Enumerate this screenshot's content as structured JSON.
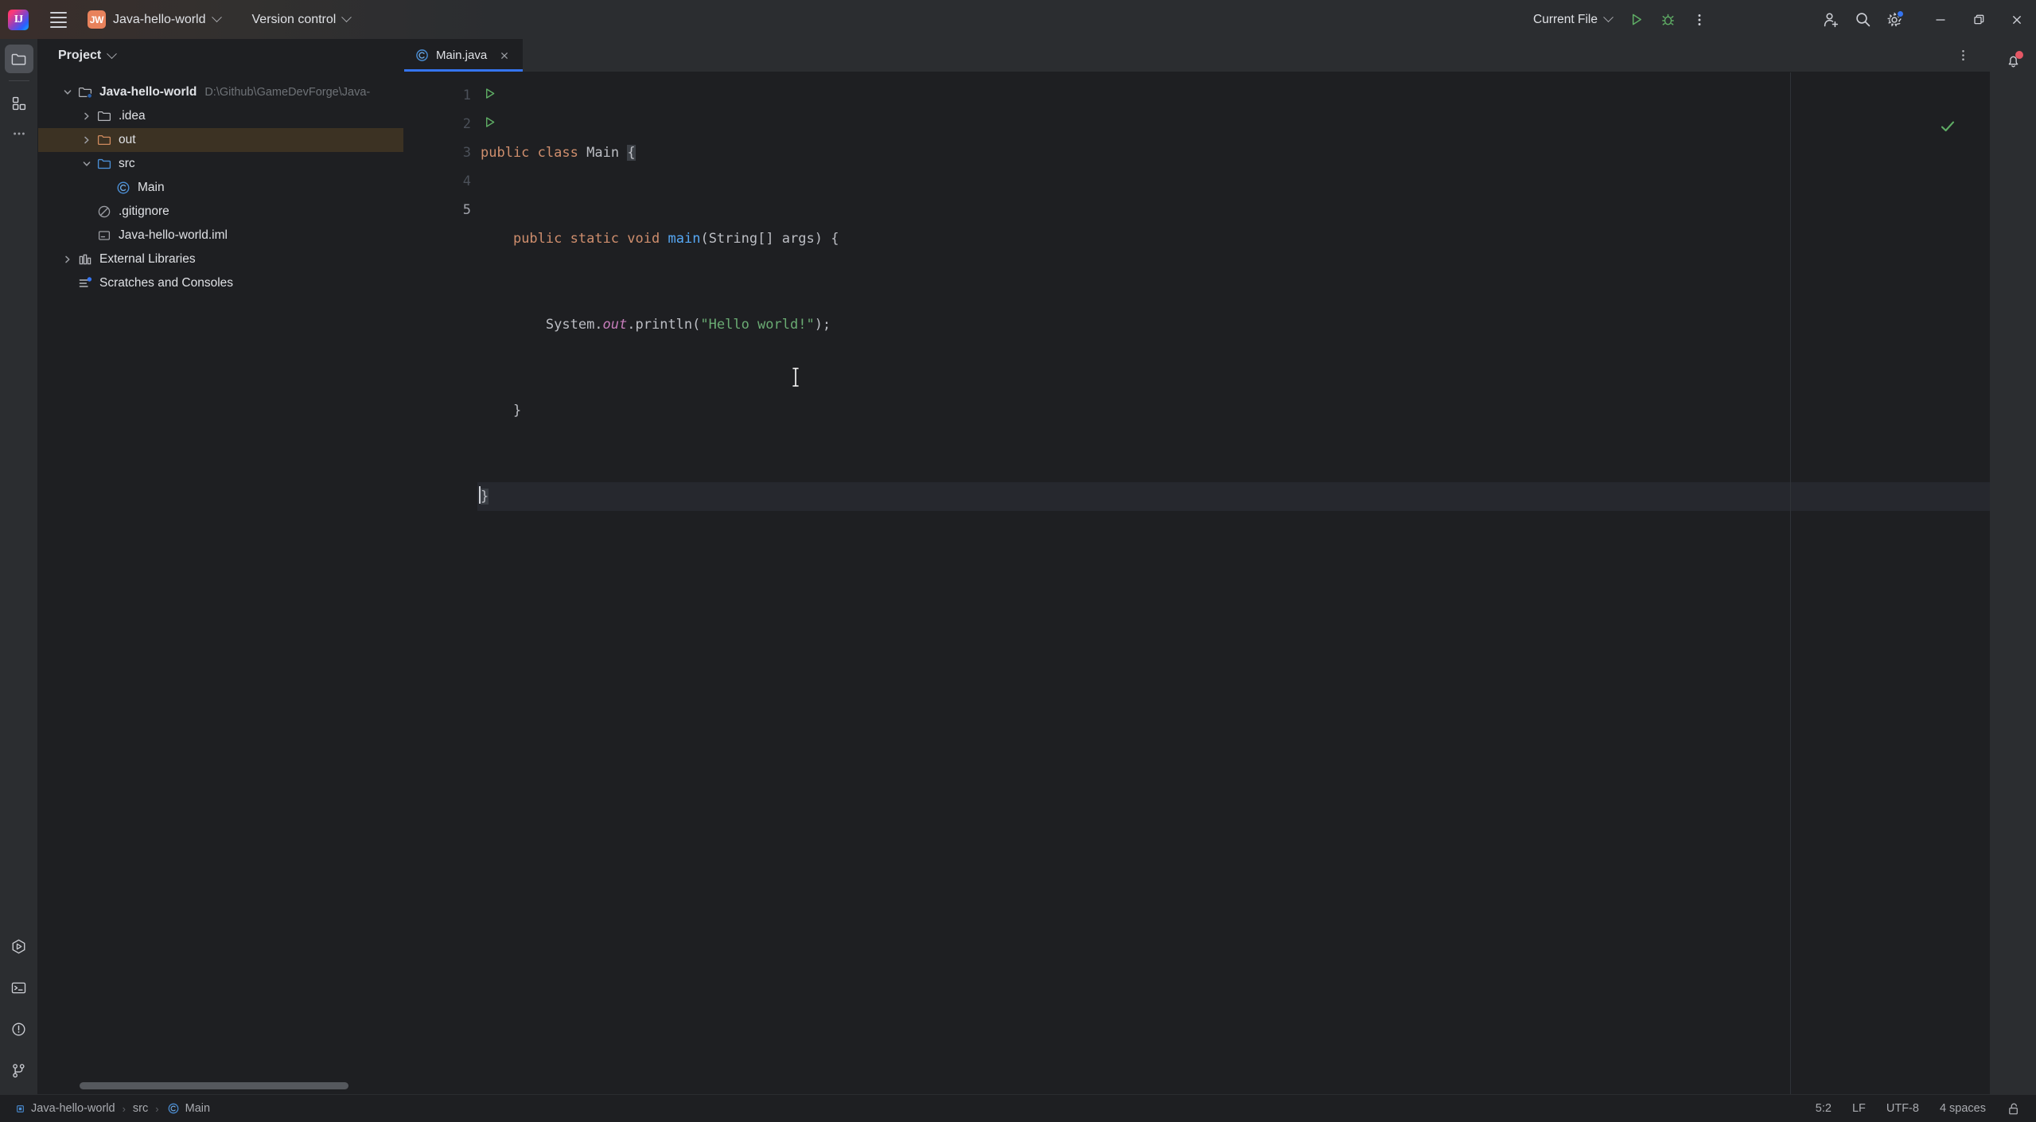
{
  "titlebar": {
    "logo_label": "IJ",
    "menu_icon": "hamburger-menu-icon",
    "project_initials": "JW",
    "project_name": "Java-hello-world",
    "version_control_label": "Version control",
    "run_config_label": "Current File",
    "run_icon": "run-icon",
    "debug_icon": "debug-icon",
    "more_icon": "more-vertical-icon",
    "account_icon": "add-account-icon",
    "search_icon": "search-icon",
    "settings_icon": "settings-gear-icon",
    "minimize_label": "—",
    "maximize_label": "❐",
    "close_label": "✕"
  },
  "rail": {
    "top": [
      {
        "name": "project-tool-window",
        "icon": "folder-icon",
        "active": true
      },
      {
        "name": "structure-tool-window",
        "icon": "modules-icon",
        "active": false
      },
      {
        "name": "more-tool-windows",
        "icon": "more-horizontal-icon",
        "active": false
      }
    ],
    "bottom": [
      {
        "name": "run-tool-window",
        "icon": "run-hexagon-icon"
      },
      {
        "name": "terminal-tool-window",
        "icon": "terminal-icon"
      },
      {
        "name": "problems-tool-window",
        "icon": "warning-circle-icon"
      },
      {
        "name": "git-tool-window",
        "icon": "git-branch-icon"
      }
    ]
  },
  "project_panel": {
    "title": "Project",
    "tree": [
      {
        "label": "Java-hello-world",
        "path": "D:\\Github\\GameDevForge\\Java-",
        "icon": "project-folder-icon",
        "indent": 0,
        "twisty": "down",
        "bold": true,
        "selected": false
      },
      {
        "label": ".idea",
        "path": "",
        "icon": "folder-icon",
        "indent": 1,
        "twisty": "right",
        "bold": false,
        "selected": false
      },
      {
        "label": "out",
        "path": "",
        "icon": "folder-excluded-icon",
        "indent": 1,
        "twisty": "right",
        "bold": false,
        "selected": true
      },
      {
        "label": "src",
        "path": "",
        "icon": "folder-source-icon",
        "indent": 1,
        "twisty": "down",
        "bold": false,
        "selected": false
      },
      {
        "label": "Main",
        "path": "",
        "icon": "java-class-icon",
        "indent": 2,
        "twisty": "none",
        "bold": false,
        "selected": false
      },
      {
        "label": ".gitignore",
        "path": "",
        "icon": "gitignore-icon",
        "indent": 1,
        "twisty": "none",
        "bold": false,
        "selected": false
      },
      {
        "label": "Java-hello-world.iml",
        "path": "",
        "icon": "iml-file-icon",
        "indent": 1,
        "twisty": "none",
        "bold": false,
        "selected": false
      },
      {
        "label": "External Libraries",
        "path": "",
        "icon": "libraries-icon",
        "indent": 0,
        "twisty": "right",
        "bold": false,
        "selected": false
      },
      {
        "label": "Scratches and Consoles",
        "path": "",
        "icon": "scratches-icon",
        "indent": 0,
        "twisty": "none",
        "bold": false,
        "selected": false
      }
    ]
  },
  "editor": {
    "tab_label": "Main.java",
    "tab_icon": "java-class-icon",
    "tab_close_icon": "close-icon",
    "options_icon": "more-vertical-icon",
    "inspection_status_icon": "check-ok-icon",
    "notifications_icon": "bell-icon",
    "lines": [
      {
        "n": "1",
        "runnable": true,
        "current": false
      },
      {
        "n": "2",
        "runnable": true,
        "current": false
      },
      {
        "n": "3",
        "runnable": false,
        "current": false
      },
      {
        "n": "4",
        "runnable": false,
        "current": false
      },
      {
        "n": "5",
        "runnable": false,
        "current": true
      }
    ],
    "code": {
      "l1_kw1": "public",
      "l1_kw2": "class",
      "l1_name": "Main",
      "l1_brace": "{",
      "l2_kw1": "public",
      "l2_kw2": "static",
      "l2_kw3": "void",
      "l2_fn": "main",
      "l2_rest": "(String[] args) {",
      "l3_sys": "System.",
      "l3_out": "out",
      "l3_print": ".println(",
      "l3_str": "\"Hello world!\"",
      "l3_end": ");",
      "l4": "}",
      "l5": "}"
    },
    "colors": {
      "keyword": "#CF8E6D",
      "string": "#6AAB73",
      "method": "#56A8F5",
      "static_field": "#C77DBB",
      "default_text": "#BCBEC4",
      "background": "#1E1F22",
      "accent": "#3574F0"
    }
  },
  "statusbar": {
    "breadcrumbs": [
      "Java-hello-world",
      "src",
      "Main"
    ],
    "breadcrumb_icon": "module-icon",
    "breadcrumb_class_icon": "java-class-icon",
    "caret_position": "5:2",
    "line_separator": "LF",
    "encoding": "UTF-8",
    "indent": "4 spaces",
    "lock_icon": "unlocked-icon"
  }
}
